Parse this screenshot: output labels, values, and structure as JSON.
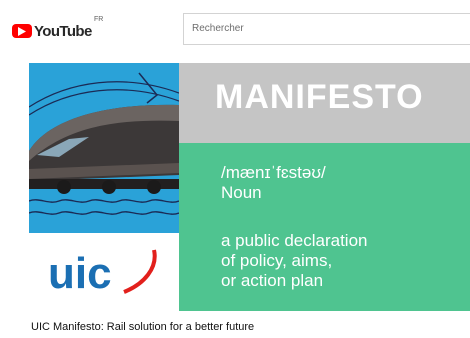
{
  "header": {
    "logo_text": "YouTube",
    "region": "FR",
    "search_placeholder": "Rechercher"
  },
  "thumbnail": {
    "title_word": "MANIFESTO",
    "phonetic": "/mænɪˈfɛstəʊ/",
    "part_of_speech": "Noun",
    "definition_lines": [
      "a public declaration",
      "of policy, aims,",
      "or action plan"
    ],
    "logo_text": "uic"
  },
  "video": {
    "title": "UIC Manifesto: Rail solution for a better future"
  },
  "colors": {
    "youtube_red": "#ff0000",
    "train_bg": "#2aa2d8",
    "manifesto_band": "#c5c5c5",
    "definition_panel": "#4fc490",
    "uic_blue": "#1b6fb3",
    "uic_red": "#e2201c"
  }
}
